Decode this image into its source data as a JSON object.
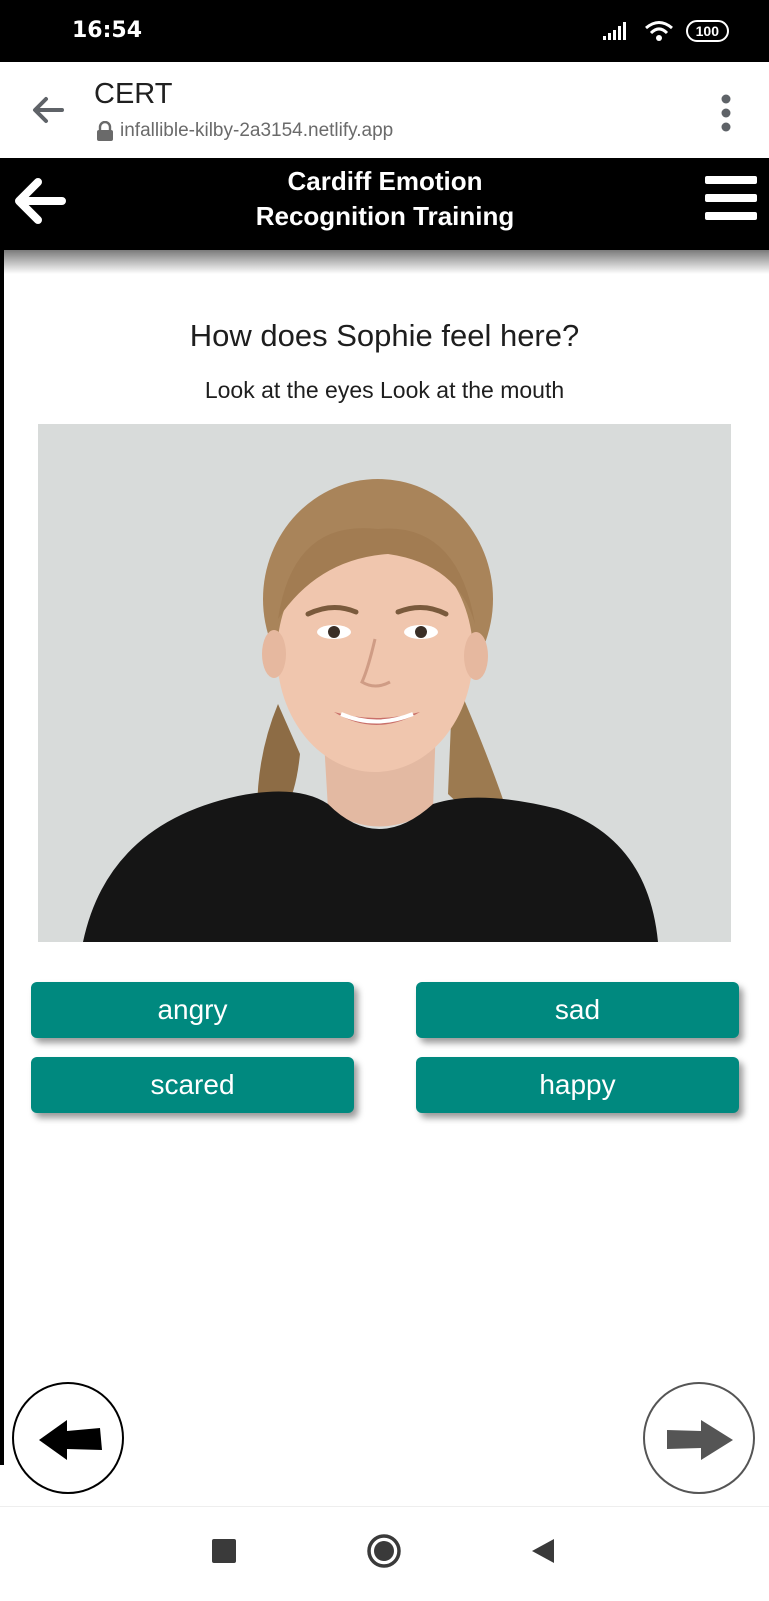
{
  "status_bar": {
    "time": "16:54",
    "battery": "100"
  },
  "browser": {
    "title": "CERT",
    "url": "infallible-kilby-2a3154.netlify.app"
  },
  "app": {
    "title_line1": "Cardiff Emotion",
    "title_line2": "Recognition Training"
  },
  "question": {
    "text": "How does Sophie feel here?",
    "hint": "Look at the eyes Look at the mouth"
  },
  "answers": [
    "angry",
    "sad",
    "scared",
    "happy"
  ],
  "colors": {
    "answer_button": "#00897f",
    "header": "#000000"
  },
  "icons": {
    "browser_back": "arrow-left-icon",
    "app_back": "arrow-left-icon",
    "menu": "hamburger-icon",
    "prev": "arrow-left-icon",
    "next": "arrow-right-icon"
  }
}
